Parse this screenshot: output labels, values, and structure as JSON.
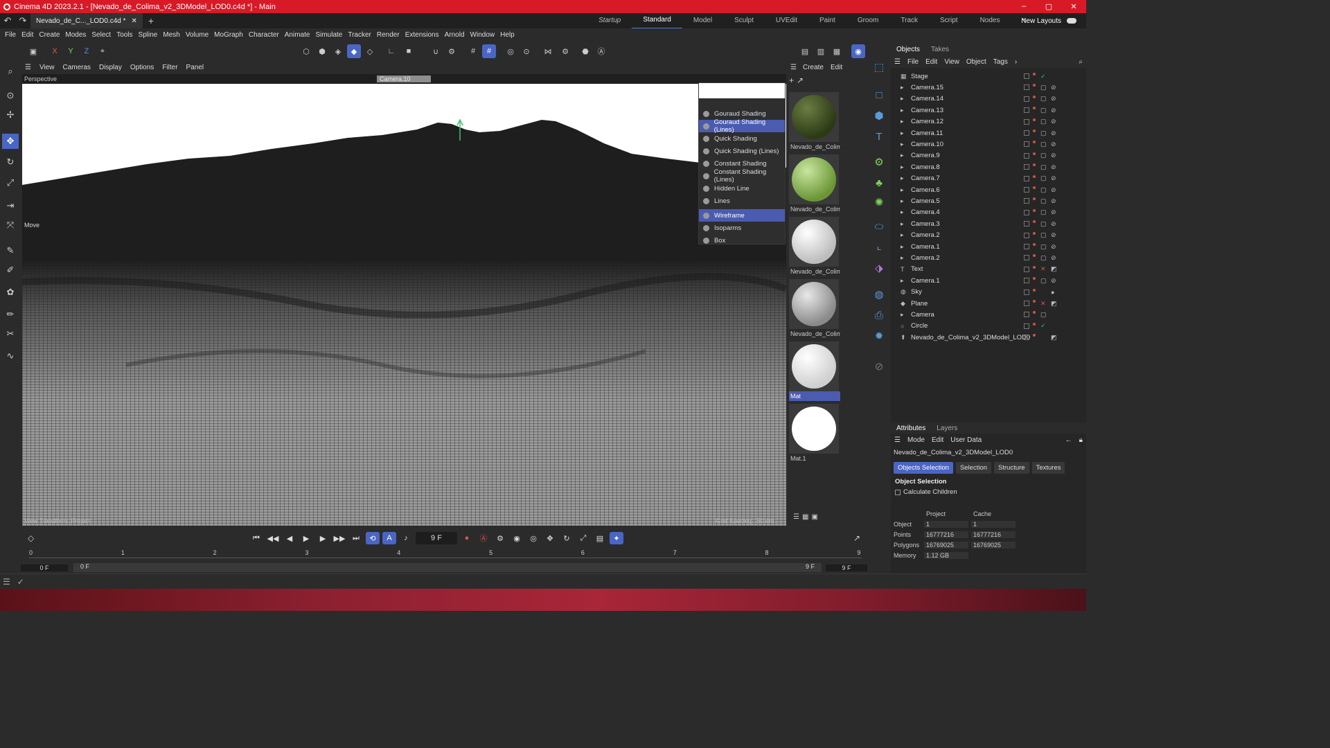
{
  "window": {
    "title": "Cinema 4D 2023.2.1 - [Nevado_de_Colima_v2_3DModel_LOD0.c4d *] - Main",
    "min": "–",
    "max": "▢",
    "close": "✕"
  },
  "tabs": {
    "doc_tab": "Nevado_de_C..._LOD0.c4d *",
    "close": "✕",
    "add": "+"
  },
  "layouts": [
    "Startup",
    "Standard",
    "Model",
    "Sculpt",
    "UVEdit",
    "Paint",
    "Groom",
    "Track",
    "Script",
    "Nodes"
  ],
  "layout_active": "Standard",
  "layout_add": "+",
  "new_layouts": "New Layouts",
  "menu": [
    "File",
    "Edit",
    "Create",
    "Modes",
    "Select",
    "Tools",
    "Spline",
    "Mesh",
    "Volume",
    "MoGraph",
    "Character",
    "Animate",
    "Simulate",
    "Tracker",
    "Render",
    "Extensions",
    "Arnold",
    "Window",
    "Help"
  ],
  "axis": {
    "x": "X",
    "y": "Y",
    "z": "Z"
  },
  "viewport_menu": [
    "View",
    "Cameras",
    "Display",
    "Options",
    "Filter",
    "Panel"
  ],
  "viewport": {
    "label": "Perspective",
    "camera": "Camera.10",
    "move": "Move",
    "bottom_left": "View Transform: Project",
    "bottom_right": "Grid Spacing : 50 cm"
  },
  "display_menu": {
    "items": [
      "Gouraud Shading",
      "Gouraud Shading (Lines)",
      "Quick Shading",
      "Quick Shading (Lines)",
      "Constant Shading",
      "Constant Shading (Lines)",
      "Hidden Line",
      "Lines",
      "Wireframe",
      "Isoparms",
      "Box"
    ],
    "highlighted": [
      "Gouraud Shading (Lines)",
      "Wireframe"
    ]
  },
  "materials": {
    "menu": [
      "Create",
      "Edit"
    ],
    "items": [
      {
        "name": "Nevado_de_Colim",
        "color": "#3b4a22"
      },
      {
        "name": "Nevado_de_Colim",
        "color": "#7fa34a"
      },
      {
        "name": "Nevado_de_Colim",
        "color": "#d8d8d8"
      },
      {
        "name": "Nevado_de_Colim",
        "color": "#b8b8b8"
      },
      {
        "name": "Mat",
        "color": "#e0e0e0"
      },
      {
        "name": "Mat.1",
        "color": "#ffffff"
      }
    ]
  },
  "objects_panel": {
    "tabs": [
      "Objects",
      "Takes"
    ],
    "menu": [
      "File",
      "Edit",
      "View",
      "Object",
      "Tags"
    ],
    "items": [
      "Stage",
      "Camera.15",
      "Camera.14",
      "Camera.13",
      "Camera.12",
      "Camera.11",
      "Camera.10",
      "Camera.9",
      "Camera.8",
      "Camera.7",
      "Camera.6",
      "Camera.5",
      "Camera.4",
      "Camera.3",
      "Camera.2",
      "Camera.1",
      "Camera.2",
      "Text",
      "Camera.1",
      "Sky",
      "Plane",
      "Camera",
      "Circle",
      "Nevado_de_Colima_v2_3DModel_LOD0"
    ]
  },
  "attributes": {
    "tabs": [
      "Attributes",
      "Layers"
    ],
    "menu": [
      "Mode",
      "Edit",
      "User Data"
    ],
    "object_name": "Nevado_de_Colima_v2_3DModel_LOD0",
    "subtabs": [
      "Objects Selection",
      "Selection",
      "Structure",
      "Textures"
    ],
    "heading": "Object Selection",
    "checkbox": "Calculate Children",
    "col_project": "Project",
    "col_cache": "Cache",
    "rows": [
      {
        "k": "Object",
        "p": "1",
        "c": "1"
      },
      {
        "k": "Points",
        "p": "16777216",
        "c": "16777216"
      },
      {
        "k": "Polygons",
        "p": "16769025",
        "c": "16769025"
      },
      {
        "k": "Memory",
        "p": "1.12 GB",
        "c": ""
      }
    ]
  },
  "timeline": {
    "current_frame": "9 F",
    "ticks": [
      "0",
      "1",
      "2",
      "3",
      "4",
      "5",
      "6",
      "7",
      "8",
      "9"
    ],
    "start": "0 F",
    "range_start": "0 F",
    "range_end": "9 F",
    "end": "9 F"
  }
}
